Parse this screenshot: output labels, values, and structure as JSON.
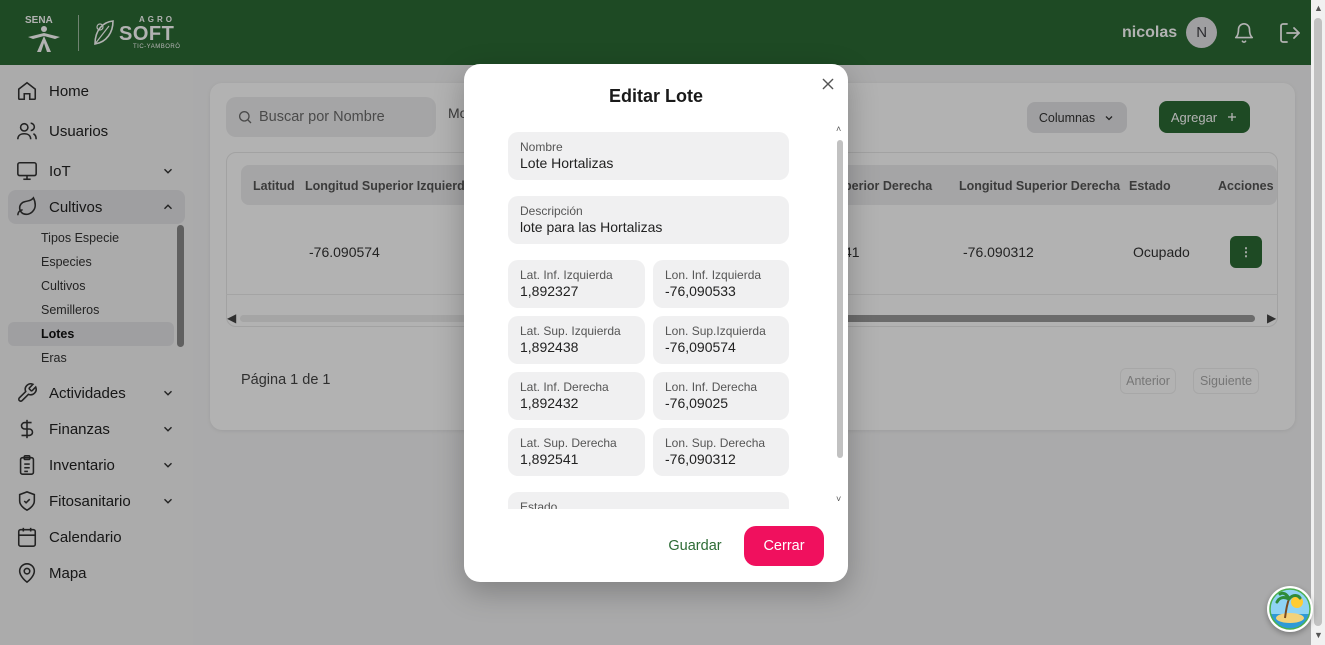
{
  "header": {
    "logo_sena": "SENA",
    "logo_agro": "AGRO",
    "logo_soft": "SOFT",
    "logo_sub": "TIC-YAMBORÓ",
    "username": "nicolas",
    "avatar_initial": "N",
    "brand_color": "#2c6b34"
  },
  "sidebar": {
    "items": [
      {
        "label": "Home",
        "icon": "home-icon"
      },
      {
        "label": "Usuarios",
        "icon": "users-icon"
      },
      {
        "label": "IoT",
        "icon": "monitor-icon"
      },
      {
        "label": "Cultivos",
        "icon": "leaf-icon"
      },
      {
        "label": "Actividades",
        "icon": "wrench-icon"
      },
      {
        "label": "Finanzas",
        "icon": "dollar-icon"
      },
      {
        "label": "Inventario",
        "icon": "clipboard-icon"
      },
      {
        "label": "Fitosanitario",
        "icon": "shield-icon"
      },
      {
        "label": "Calendario",
        "icon": "calendar-icon"
      },
      {
        "label": "Mapa",
        "icon": "map-pin-icon"
      }
    ],
    "subitems": [
      "Tipos Especie",
      "Especies",
      "Cultivos",
      "Semilleros",
      "Lotes",
      "Eras"
    ]
  },
  "toolbar": {
    "search_placeholder": "Buscar por Nombre",
    "mo_text": "Mo",
    "columns_label": "Columnas",
    "add_label": "Agregar"
  },
  "table": {
    "headers": [
      "Latitud",
      "Longitud Superior Izquierda",
      "perior Derecha",
      "Longitud Superior Derecha",
      "Estado",
      "Acciones"
    ],
    "row": {
      "lon_sup_izq": "-76.090574",
      "partial": "41",
      "lon_sup_der": "-76.090312",
      "estado": "Ocupado",
      "actions_glyph": "⋮"
    }
  },
  "pagination": {
    "info": "Página 1 de 1",
    "prev": "Anterior",
    "next": "Siguiente"
  },
  "modal": {
    "title": "Editar Lote",
    "fields": {
      "nombre": {
        "label": "Nombre",
        "value": "Lote Hortalizas"
      },
      "descripcion": {
        "label": "Descripción",
        "value": "lote para las Hortalizas"
      },
      "lat_inf_izq": {
        "label": "Lat. Inf. Izquierda",
        "value": "1,892327"
      },
      "lon_inf_izq": {
        "label": "Lon. Inf. Izquierda",
        "value": "-76,090533"
      },
      "lat_sup_izq": {
        "label": "Lat. Sup. Izquierda",
        "value": "1,892438"
      },
      "lon_sup_izq": {
        "label": "Lon. Sup.Izquierda",
        "value": "-76,090574"
      },
      "lat_inf_der": {
        "label": "Lat. Inf. Derecha",
        "value": "1,892432"
      },
      "lon_inf_der": {
        "label": "Lon. Inf. Derecha",
        "value": "-76,09025"
      },
      "lat_sup_der": {
        "label": "Lat. Sup. Derecha",
        "value": "1,892541"
      },
      "lon_sup_der": {
        "label": "Lon. Sup. Derecha",
        "value": "-76,090312"
      },
      "estado": {
        "label": "Estado",
        "value": ""
      }
    },
    "save_label": "Guardar",
    "close_label": "Cerrar",
    "close_color": "#f0105e"
  }
}
